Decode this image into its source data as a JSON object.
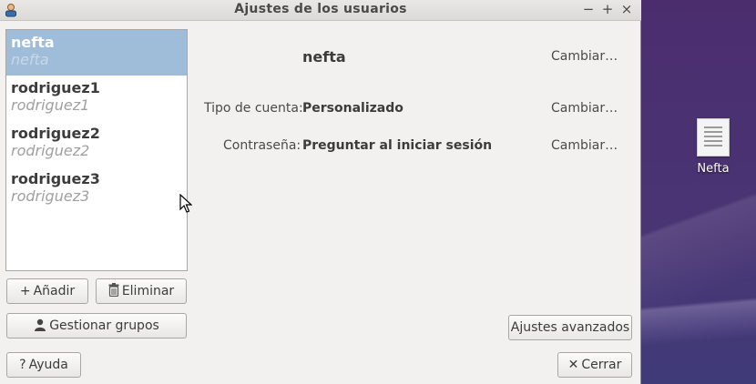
{
  "window": {
    "title": "Ajustes de los usuarios",
    "controls": {
      "minimize": "−",
      "maximize": "+",
      "close": "×"
    }
  },
  "users": [
    {
      "name": "nefta",
      "full": "nefta",
      "selected": true
    },
    {
      "name": "rodriguez1",
      "full": "rodriguez1",
      "selected": false
    },
    {
      "name": "rodriguez2",
      "full": "rodriguez2",
      "selected": false
    },
    {
      "name": "rodriguez3",
      "full": "rodriguez3",
      "selected": false
    }
  ],
  "buttons": {
    "add": "Añadir",
    "remove": "Eliminar",
    "groups": "Gestionar grupos",
    "help": "Ayuda",
    "advanced": "Ajustes avanzados",
    "close": "Cerrar"
  },
  "details": {
    "name": "nefta",
    "account_type_label": "Tipo de cuenta:",
    "account_type_value": "Personalizado",
    "password_label": "Contraseña:",
    "password_value": "Preguntar al iniciar sesión",
    "change": "Cambiar…"
  },
  "desktop": {
    "icon_label": "Nefta"
  },
  "icons": {
    "add": "+",
    "help": "?",
    "close": "✕"
  }
}
